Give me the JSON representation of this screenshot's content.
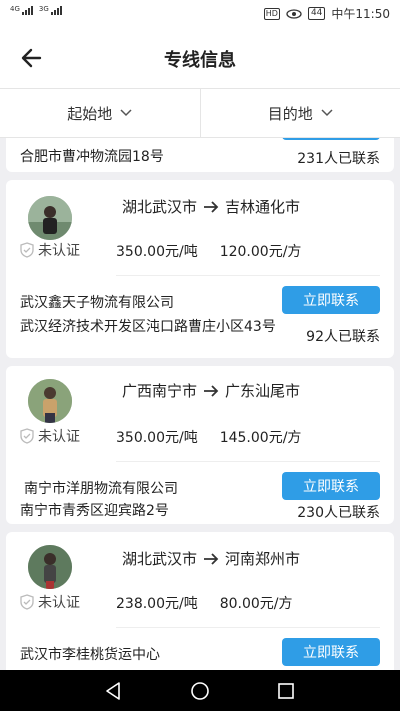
{
  "status": {
    "left_sig1": "4G",
    "left_sig2": "3G",
    "hd": "HD",
    "battery": "44",
    "time": "中午11:50"
  },
  "header": {
    "title": "专线信息"
  },
  "filters": {
    "origin": "起始地",
    "destination": "目的地"
  },
  "partial_card": {
    "address": "合肥市曹冲物流园18号",
    "contacts": "231人已联系"
  },
  "cards": [
    {
      "from": "湖北武汉市",
      "to": "吉林通化市",
      "cert": "未认证",
      "price_ton": "350.00元/吨",
      "price_cube": "120.00元/方",
      "company": "武汉鑫天子物流有限公司",
      "address": "武汉经济技术开发区沌口路曹庄小区43号",
      "contact_label": "立即联系",
      "contacts": "92人已联系"
    },
    {
      "from": "广西南宁市",
      "to": "广东汕尾市",
      "cert": "未认证",
      "price_ton": "350.00元/吨",
      "price_cube": "145.00元/方",
      "company": "南宁市洋朋物流有限公司",
      "address": "南宁市青秀区迎宾路2号",
      "contact_label": "立即联系",
      "contacts": "230人已联系"
    },
    {
      "from": "湖北武汉市",
      "to": "河南郑州市",
      "cert": "未认证",
      "price_ton": "238.00元/吨",
      "price_cube": "80.00元/方",
      "company": "武汉市李桂桃货运中心",
      "contact_label": "立即联系"
    }
  ],
  "icons": {
    "back": "arrow-left-icon",
    "arrow": "arrow-right-icon",
    "shield": "shield-icon",
    "chevron": "chevron-down-icon"
  },
  "colors": {
    "accent": "#2f9de6"
  }
}
